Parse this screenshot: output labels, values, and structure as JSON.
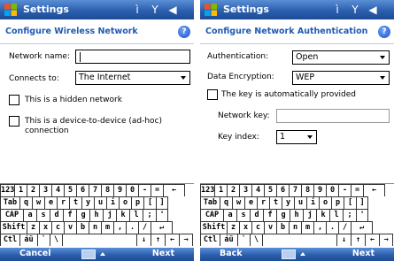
{
  "status_bar": {
    "title": "Settings"
  },
  "left": {
    "header": "Configure Wireless Network",
    "network_name_label": "Network name:",
    "network_name_value": "",
    "connects_to_label": "Connects to:",
    "connects_to_value": "The Internet",
    "hidden_network_label": "This is a hidden network",
    "adhoc_label": "This is a device-to-device (ad-hoc) connection",
    "softkey_left": "Cancel",
    "softkey_right": "Next"
  },
  "right": {
    "header": "Configure Network Authentication",
    "authentication_label": "Authentication:",
    "authentication_value": "Open",
    "encryption_label": "Data Encryption:",
    "encryption_value": "WEP",
    "auto_key_label": "The key is automatically provided",
    "network_key_label": "Network key:",
    "network_key_value": "",
    "key_index_label": "Key index:",
    "key_index_value": "1",
    "softkey_left": "Back",
    "softkey_right": "Next"
  },
  "keyboard": {
    "row1": [
      "123",
      "1",
      "2",
      "3",
      "4",
      "5",
      "6",
      "7",
      "8",
      "9",
      "0",
      "-",
      "=",
      "←"
    ],
    "row2": [
      "Tab",
      "q",
      "w",
      "e",
      "r",
      "t",
      "y",
      "u",
      "i",
      "o",
      "p",
      "[",
      "]"
    ],
    "row3": [
      "CAP",
      "a",
      "s",
      "d",
      "f",
      "g",
      "h",
      "j",
      "k",
      "l",
      ";",
      "'"
    ],
    "row4": [
      "Shift",
      "z",
      "x",
      "c",
      "v",
      "b",
      "n",
      "m",
      ",",
      ".",
      "/",
      "↵"
    ],
    "row5": [
      "Ctl",
      "áü",
      "`",
      "\\",
      " ",
      "↓",
      "↑",
      "←",
      "→"
    ]
  },
  "colors": {
    "titlebar": "#2b5fae",
    "header_text": "#1e5ab4"
  }
}
